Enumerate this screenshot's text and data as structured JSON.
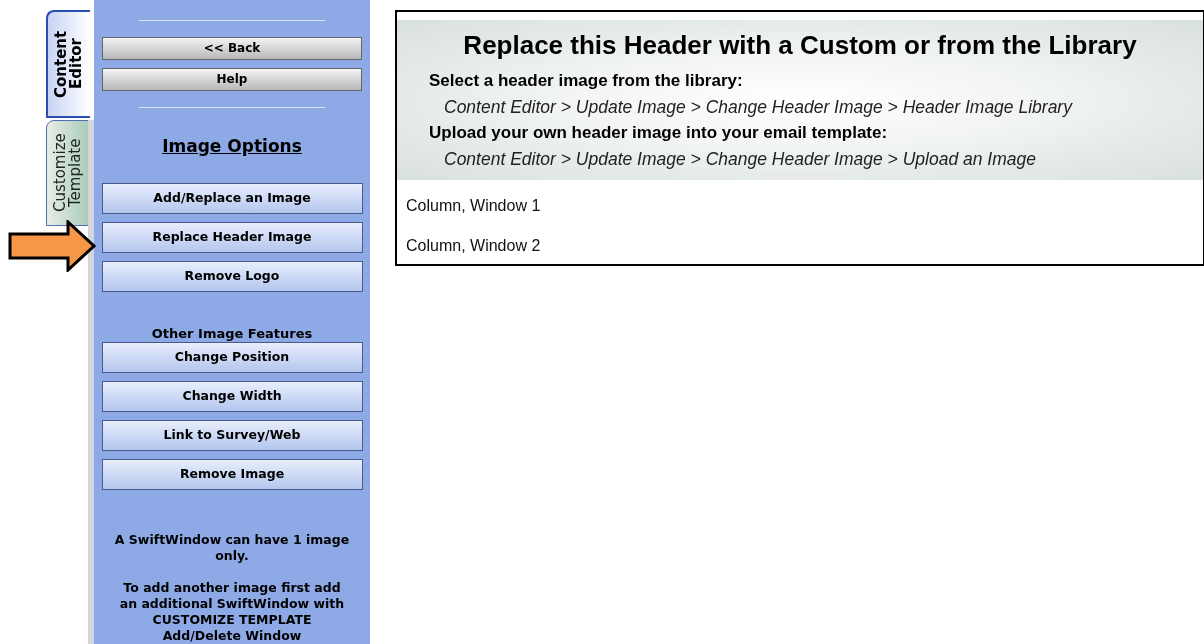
{
  "tabs": [
    {
      "label": "Content Editor",
      "selected": true
    },
    {
      "label": "Customize Template",
      "selected": false
    }
  ],
  "sidebar": {
    "nav_buttons": [
      "<< Back",
      "Help"
    ],
    "section_title": "Image Options",
    "image_buttons": [
      "Add/Replace an Image",
      "Replace Header Image",
      "Remove Logo"
    ],
    "other_title": "Other Image Features",
    "other_buttons": [
      "Change Position",
      "Change Width",
      "Link to Survey/Web",
      "Remove Image"
    ],
    "notes": [
      "A SwiftWindow can have 1 image only.",
      "To add another image first add\nan additional SwiftWindow with\nCUSTOMIZE TEMPLATE\nAdd/Delete Window"
    ]
  },
  "main": {
    "header_title": "Replace this Header with a Custom or from the Library",
    "instructions": [
      {
        "kind": "heading",
        "text": "Select a header image from the library:"
      },
      {
        "kind": "path",
        "text": "Content Editor > Update Image > Change Header Image > Header Image Library"
      },
      {
        "kind": "heading",
        "text": "Upload your own header image into your email template:"
      },
      {
        "kind": "path",
        "text": "Content Editor > Update Image > Change Header Image > Upload an Image"
      }
    ],
    "rows": [
      "Column, Window 1",
      "Column, Window 2"
    ]
  }
}
